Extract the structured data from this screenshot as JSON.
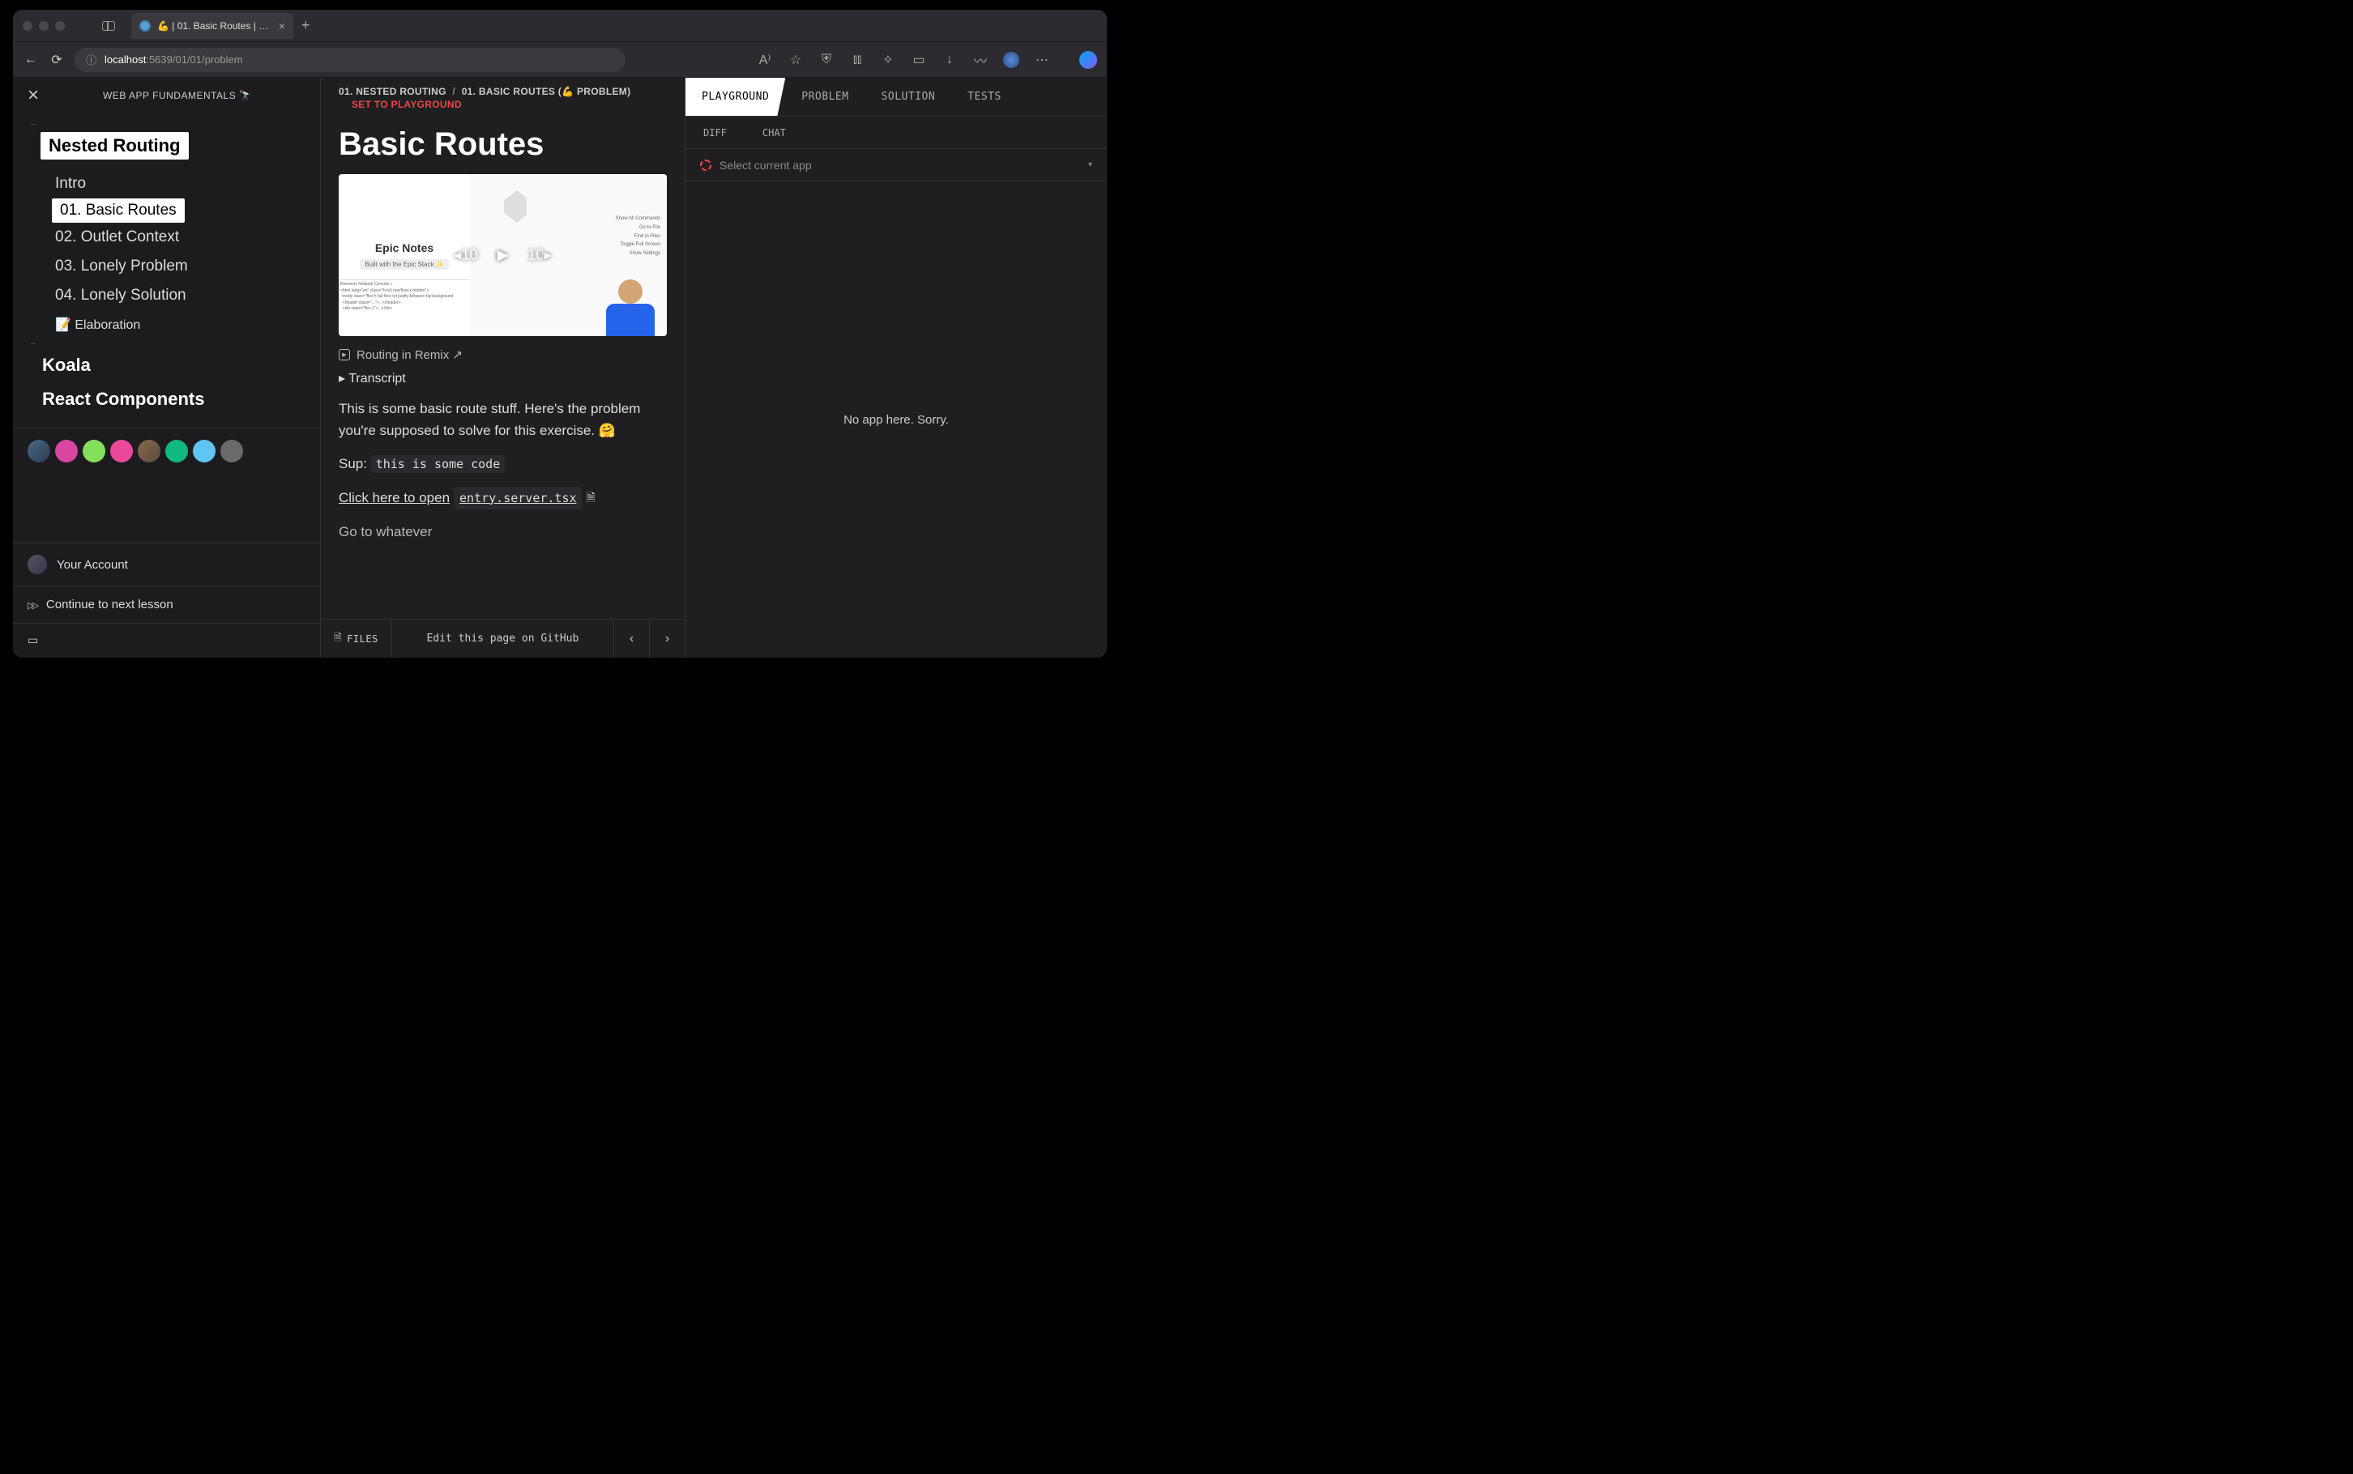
{
  "browser": {
    "tab_title": "💪 | 01. Basic Routes | 01. Nes...",
    "url_host": "localhost",
    "url_rest": ":5639/01/01/problem"
  },
  "sidebar": {
    "app_title": "WEB APP FUNDAMENTALS 🔭",
    "section_pill": "Nested Routing",
    "items": [
      {
        "label": "Intro"
      },
      {
        "label": "01. Basic Routes",
        "active": true
      },
      {
        "label": "02. Outlet Context"
      },
      {
        "label": "03. Lonely Problem"
      },
      {
        "label": "04. Lonely Solution"
      }
    ],
    "elaboration": "📝 Elaboration",
    "sections": [
      {
        "label": "Koala"
      },
      {
        "label": "React Components"
      }
    ],
    "account_label": "Your Account",
    "continue_label": "Continue to next lesson"
  },
  "center": {
    "crumb1": "01. NESTED ROUTING",
    "crumb2": "01. BASIC ROUTES (💪 PROBLEM)",
    "set_playground": "SET TO PLAYGROUND",
    "heading": "Basic Routes",
    "video": {
      "epic_notes": "Epic Notes",
      "built_with": "Built with the Epic Stack ✨",
      "seek_back": "10",
      "seek_fwd": "10",
      "menu_items": "Show All Commands\nGo to File\nFind in Files\nToggle Full Screen\nShow Settings"
    },
    "video_caption": "Routing in Remix ↗",
    "transcript": "Transcript",
    "body1": "This is some basic route stuff. Here's the problem you're supposed to solve for this exercise. 🤗",
    "sup_label": "Sup: ",
    "sup_code": "this is some code",
    "open_link_text": "Click here to open ",
    "open_link_file": "entry.server.tsx",
    "goto": "Go to whatever",
    "footer_files": "FILES",
    "footer_edit": "Edit this page on GitHub"
  },
  "right": {
    "tabs": [
      {
        "label": "PLAYGROUND",
        "active": true
      },
      {
        "label": "PROBLEM"
      },
      {
        "label": "SOLUTION"
      },
      {
        "label": "TESTS"
      }
    ],
    "subtabs": [
      {
        "label": "DIFF"
      },
      {
        "label": "CHAT"
      }
    ],
    "selector_placeholder": "Select current app",
    "empty_state": "No app here. Sorry."
  }
}
